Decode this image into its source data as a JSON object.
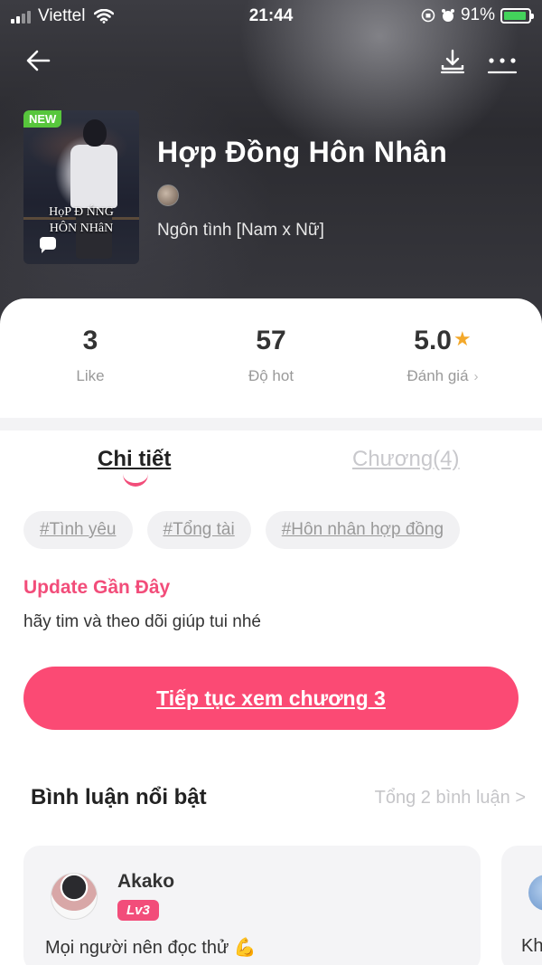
{
  "status_bar": {
    "carrier": "Viettel",
    "time": "21:44",
    "battery": "91%",
    "battery_level": 0.91
  },
  "comic": {
    "badge": "NEW",
    "cover_title_line1": "HọP Đ ŃNG",
    "cover_title_line2": "HÔN NHâN",
    "title": "Hợp Đồng Hôn Nhân",
    "genre": "Ngôn tình [Nam x Nữ]"
  },
  "stats": {
    "like_value": "3",
    "like_label": "Like",
    "hot_value": "57",
    "hot_label": "Độ hot",
    "rating_value": "5.0",
    "rating_label": "Đánh giá"
  },
  "tabs": {
    "detail": "Chi tiết",
    "chapters": "Chương(4)"
  },
  "tags": [
    "#Tình yêu",
    "#Tổng tài",
    "#Hôn nhân hợp đồng"
  ],
  "update": {
    "title": "Update Gần Đây",
    "text": "hãy tim và theo dõi giúp tui nhé"
  },
  "continue_label": "Tiếp tục xem chương 3",
  "comments": {
    "title": "Bình luận nổi bật",
    "total": "Tổng 2 bình luận >",
    "items": [
      {
        "name": "Akako",
        "level": "Lv3",
        "text": "Mọi người nên đọc thử",
        "emoji": "💪"
      },
      {
        "text": "Kh"
      }
    ]
  },
  "colors": {
    "accent": "#fb4a74",
    "new_badge": "#57c63c",
    "star": "#f3a82a"
  }
}
